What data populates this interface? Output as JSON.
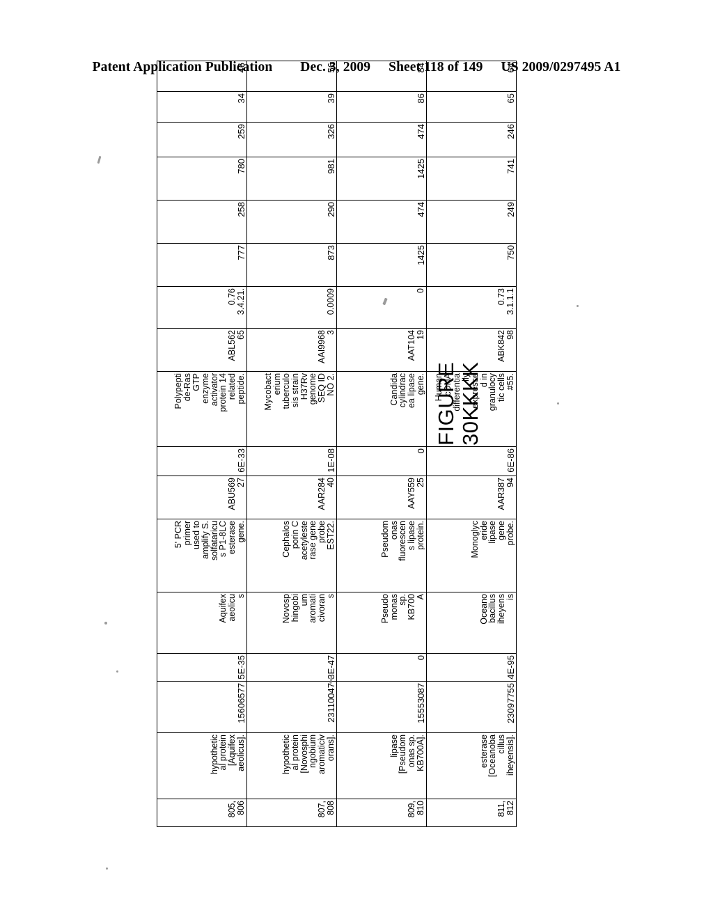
{
  "header": {
    "publication": "Patent Application Publication",
    "date": "Dec. 3, 2009",
    "sheet": "Sheet 118 of 149",
    "document_number": "US 2009/0297495 A1"
  },
  "figure": {
    "label_line1": "FIGURE",
    "label_line2": "30KKKK"
  },
  "table": {
    "rows": [
      {
        "id": "805,\n806",
        "id_line1": "805,",
        "id_line2": "806",
        "desc1": "hypothetic al protein [Aquifex aeolicus].",
        "desc1_lines": [
          "hypothetic",
          "al protein",
          "[Aquifex",
          "aeolicus]."
        ],
        "acc1": "15606577",
        "ev1": "5E-35",
        "org": "Aquifex aeolicu s",
        "org_lines": [
          "Aquifex",
          "aeolicu",
          "s"
        ],
        "desc2_lines": [
          "5' PCR",
          "primer",
          "used to",
          "amplify S.",
          "solfataricu",
          "s P1-8LC",
          "esterase",
          "gene."
        ],
        "acc2": "ABU569 27",
        "acc2_lines": [
          "ABU569",
          "27"
        ],
        "ev2": "6E-33",
        "desc3_lines": [
          "Polypepti",
          "de-Ras",
          "GTP",
          "enzyme",
          "activator",
          "protein 14",
          "related",
          "peptide."
        ],
        "acc3_lines": [
          "ABL562",
          "65"
        ],
        "score_lines": [
          "0.76",
          "3.4.21."
        ],
        "n1": "777",
        "n2": "258",
        "n3": "780",
        "n4": "259",
        "n5": "34",
        "n6": "46"
      },
      {
        "id_line1": "807,",
        "id_line2": "808",
        "desc1_lines": [
          "hypothetic",
          "al protein",
          "[Novosphi",
          "ngobium",
          "aromaticiv",
          "orans]."
        ],
        "acc1": "23110047",
        "ev1": "3E-47",
        "org_lines": [
          "Novosp",
          "hingobi",
          "um",
          "aromati",
          "civoran",
          "s"
        ],
        "desc2_lines": [
          "Cephalos",
          "porin C",
          "acetyleste",
          "rase gene",
          "probe",
          "EST22."
        ],
        "acc2_lines": [
          "AAR284",
          "40"
        ],
        "ev2": "1E-08",
        "desc3_lines": [
          "Mycobact",
          "erium",
          "tuberculo",
          "sis strain",
          "H37Rv",
          "genome",
          "SEQ ID",
          "NO 2."
        ],
        "acc3_lines": [
          "AAI9968",
          "3"
        ],
        "score_lines": [
          "0.0009"
        ],
        "n1": "873",
        "n2": "290",
        "n3": "981",
        "n4": "326",
        "n5": "39",
        "n6": "56"
      },
      {
        "id_line1": "809,",
        "id_line2": "810",
        "desc1_lines": [
          "lipase",
          "[Pseudom",
          "onas sp.",
          "KB700A]."
        ],
        "acc1": "15553087",
        "ev1": "0",
        "org_lines": [
          "Pseudo",
          "monas",
          "sp.",
          "KB700",
          "A"
        ],
        "desc2_lines": [
          "Pseudom",
          "onas",
          "fluorescen",
          "s lipase",
          "protein."
        ],
        "acc2_lines": [
          "AAY559",
          "25"
        ],
        "ev2": "0",
        "desc3_lines": [
          "Candida",
          "cylindrac",
          "ea lipase",
          "gene."
        ],
        "acc3_lines": [
          "AAT104",
          "19"
        ],
        "score_lines": [
          "0"
        ],
        "n1": "1425",
        "n2": "474",
        "n3": "1425",
        "n4": "474",
        "n5": "86",
        "n6": "84"
      },
      {
        "id_line1": "811,",
        "id_line2": "812",
        "desc1_lines": [
          "esterase",
          "[Oceanoba",
          "cillus",
          "iheyensis]."
        ],
        "acc1": "23097755",
        "ev1": "4E-95",
        "org_lines": [
          "Oceano",
          "bacillus",
          "iheyens",
          "is"
        ],
        "desc2_lines": [
          "Monoglyc",
          "eride",
          "lipase",
          "gene",
          "probe."
        ],
        "acc2_lines": [
          "AAR387",
          "94"
        ],
        "ev2": "6E-86",
        "desc3_lines": [
          "Human",
          "cDNA",
          "differentia",
          "lly",
          "expresse",
          "d in",
          "granulocy",
          "tic cells",
          "#55."
        ],
        "acc3_lines": [
          "ABK842",
          "98"
        ],
        "score_lines": [
          "0.73",
          "3.1.1.1"
        ],
        "n1": "750",
        "n2": "249",
        "n3": "741",
        "n4": "246",
        "n5": "65",
        "n6": "64"
      }
    ]
  }
}
